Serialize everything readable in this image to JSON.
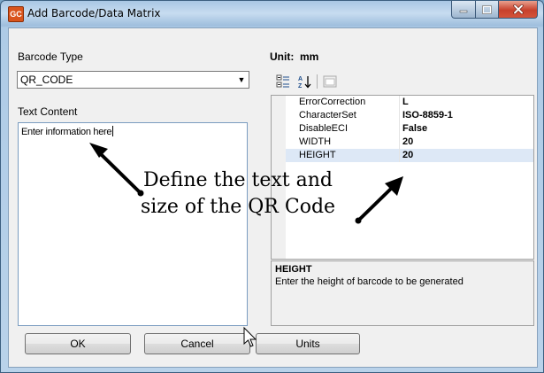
{
  "window": {
    "app_icon_text": "GC",
    "title": "Add Barcode/Data Matrix",
    "caption_buttons": {
      "minimize": "—",
      "maximize": "☐",
      "close": "✕"
    }
  },
  "barcode_type": {
    "label": "Barcode Type",
    "selected": "QR_CODE"
  },
  "text_content": {
    "label": "Text Content",
    "value": "Enter information here"
  },
  "unit": {
    "label": "Unit:",
    "value": "mm"
  },
  "property_grid": {
    "rows": [
      {
        "key": "ErrorCorrection",
        "value": "L"
      },
      {
        "key": "CharacterSet",
        "value": "ISO-8859-1"
      },
      {
        "key": "DisableECI",
        "value": "False"
      },
      {
        "key": "WIDTH",
        "value": "20"
      },
      {
        "key": "HEIGHT",
        "value": "20"
      }
    ],
    "selected_row_index": 4,
    "help_title": "HEIGHT",
    "help_text": "Enter the height of barcode to be generated"
  },
  "buttons": {
    "ok": "OK",
    "cancel": "Cancel",
    "units": "Units"
  },
  "annotation": {
    "line1": "Define the text and",
    "line2": "size of the QR Code"
  }
}
